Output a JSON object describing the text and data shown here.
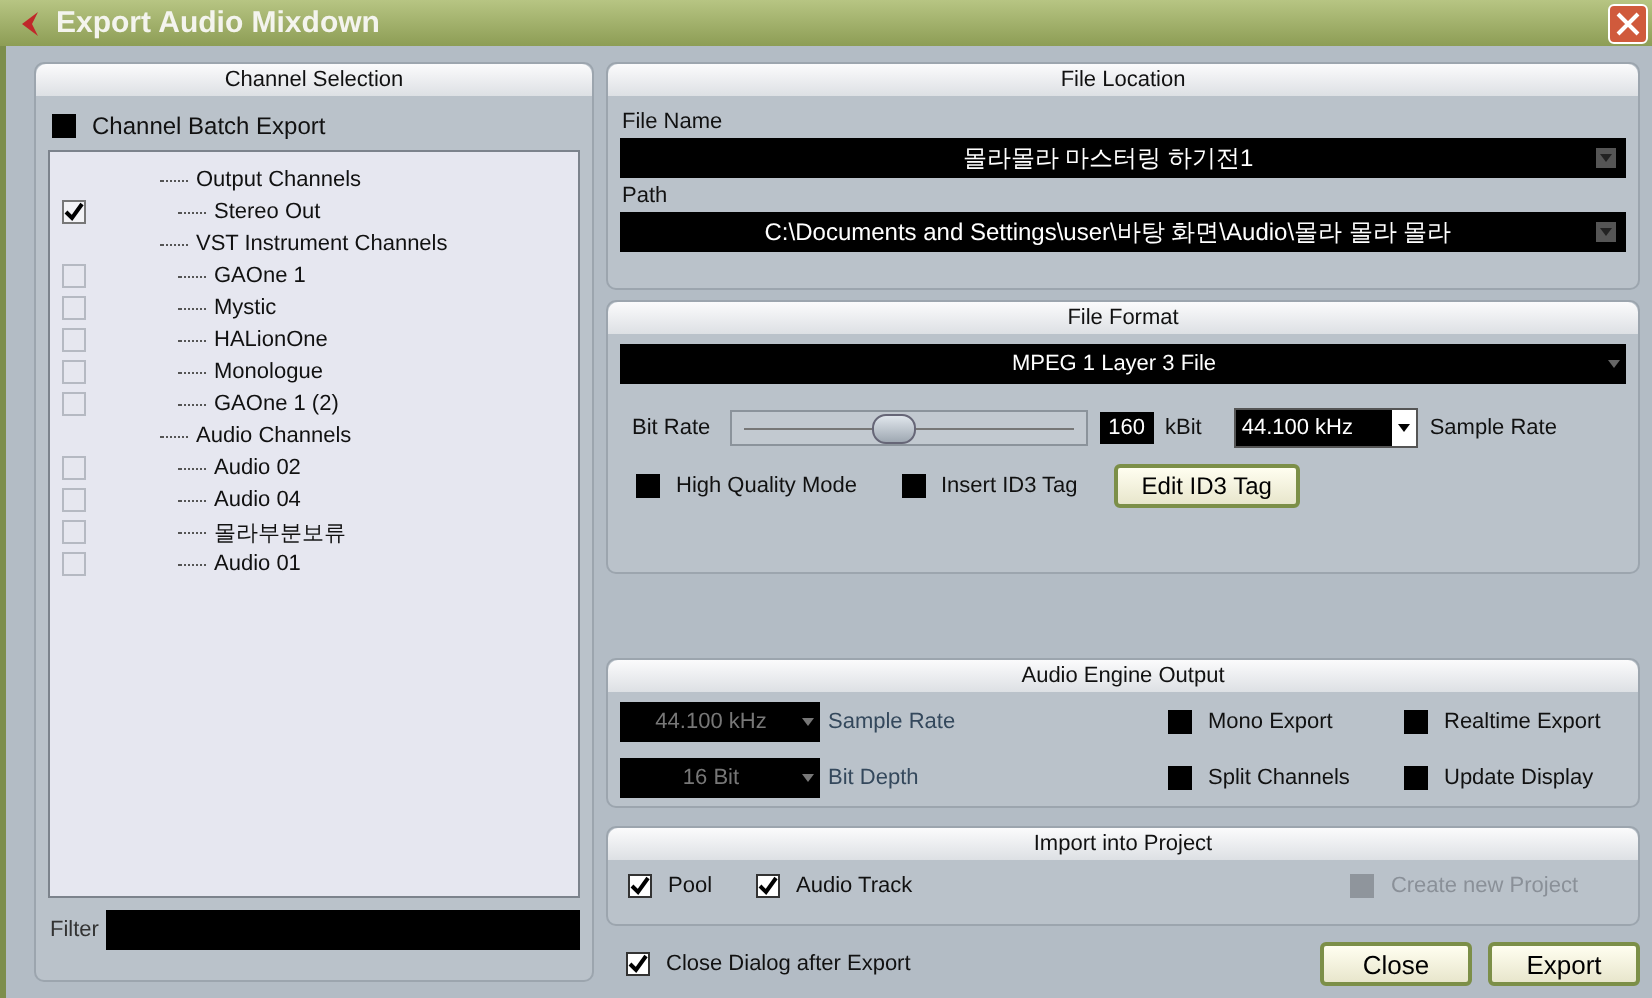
{
  "window": {
    "title": "Export Audio Mixdown"
  },
  "channel_selection": {
    "heading": "Channel Selection",
    "batch_export": {
      "label": "Channel Batch Export",
      "checked": false
    },
    "tree": [
      {
        "label": "Output Channels",
        "children": [
          {
            "label": "Stereo Out",
            "checked": true
          }
        ]
      },
      {
        "label": "VST Instrument Channels",
        "children": [
          {
            "label": "GAOne 1",
            "checked": false
          },
          {
            "label": "Mystic",
            "checked": false
          },
          {
            "label": "HALionOne",
            "checked": false
          },
          {
            "label": "Monologue",
            "checked": false
          },
          {
            "label": "GAOne 1 (2)",
            "checked": false
          }
        ]
      },
      {
        "label": "Audio Channels",
        "children": [
          {
            "label": "Audio 02",
            "checked": false
          },
          {
            "label": "Audio 04",
            "checked": false
          },
          {
            "label": "몰라부분보류",
            "checked": false
          },
          {
            "label": "Audio 01",
            "checked": false
          }
        ]
      }
    ],
    "filter_label": "Filter"
  },
  "file_location": {
    "heading": "File Location",
    "file_name_label": "File Name",
    "file_name": "몰라몰라 마스터링 하기전1",
    "path_label": "Path",
    "path": "C:\\Documents and Settings\\user\\바탕 화면\\Audio\\몰라 몰라 몰라"
  },
  "file_format": {
    "heading": "File Format",
    "format": "MPEG 1 Layer 3 File",
    "bit_rate_label": "Bit Rate",
    "bit_rate": {
      "level": 0.46
    },
    "bit_rate_value": "160",
    "bit_rate_unit": "kBit",
    "sample_rate": "44.100 kHz",
    "sample_rate_label": "Sample Rate",
    "options": [
      {
        "label": "High Quality Mode",
        "checked": false
      },
      {
        "label": "Insert ID3 Tag",
        "checked": false
      }
    ],
    "edit_button": "Edit ID3 Tag"
  },
  "audio_engine_output": {
    "heading": "Audio Engine Output",
    "selects": [
      {
        "value": "44.100 kHz",
        "label": "Sample Rate",
        "disabled": true
      },
      {
        "value": "16 Bit",
        "label": "Bit Depth",
        "disabled": true
      }
    ],
    "options": [
      {
        "label": "Mono Export",
        "checked": false
      },
      {
        "label": "Realtime Export",
        "checked": false
      },
      {
        "label": "Split Channels",
        "checked": false
      },
      {
        "label": "Update Display",
        "checked": false
      }
    ]
  },
  "import_into_project": {
    "heading": "Import into Project",
    "options": [
      {
        "label": "Pool",
        "checked": true,
        "disabled": false
      },
      {
        "label": "Audio Track",
        "checked": true,
        "disabled": false
      },
      {
        "label": "Create new Project",
        "checked": false,
        "disabled": true
      }
    ]
  },
  "close_dialog": {
    "label": "Close Dialog after Export",
    "checked": true
  },
  "buttons": [
    "Close",
    "Export"
  ]
}
